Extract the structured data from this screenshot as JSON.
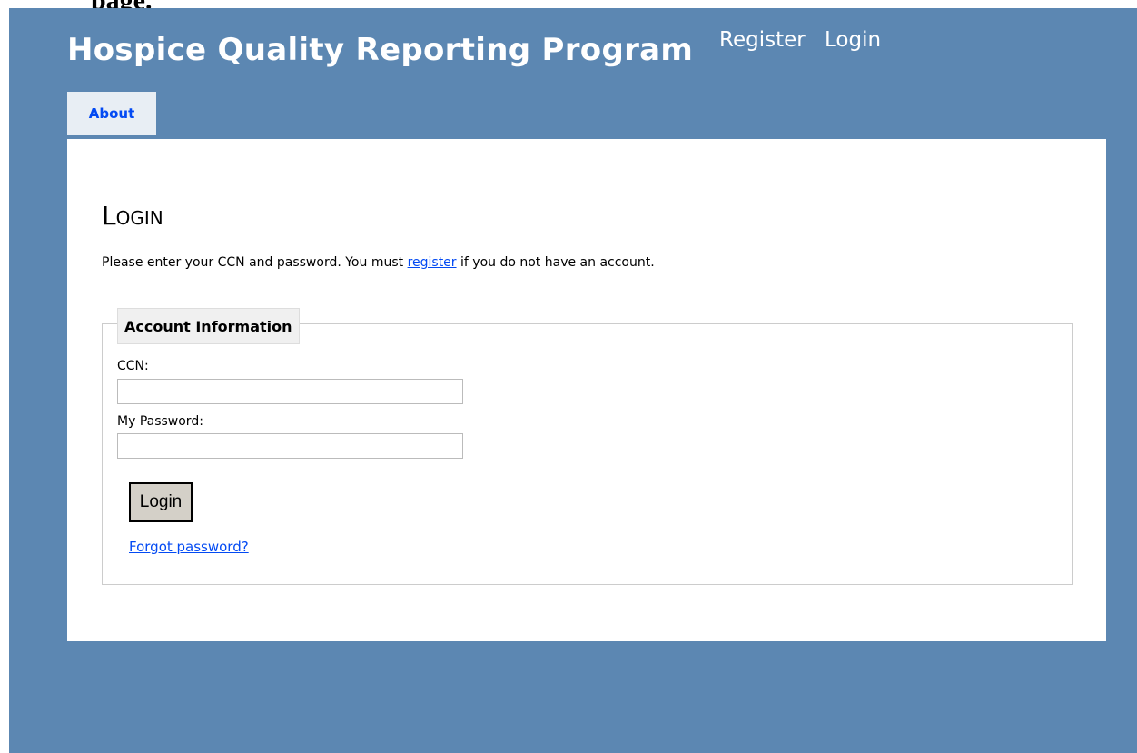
{
  "doc_fragment": "page.",
  "header": {
    "title": "Hospice Quality Reporting Program",
    "links": {
      "register": "Register",
      "login": "Login"
    }
  },
  "nav": {
    "tab_about": "About"
  },
  "main": {
    "heading": "Login",
    "intro": {
      "before": "Please enter your CCN and password. You must ",
      "link": "register",
      "after": " if you do not have an account."
    },
    "fieldset": {
      "legend": "Account Information",
      "ccn_label": "CCN:",
      "ccn_value": "",
      "password_label": "My Password:",
      "password_value": "",
      "login_button": "Login",
      "forgot_link": "Forgot password?"
    }
  },
  "colors": {
    "background": "#5c87b2",
    "link": "#034af3",
    "tab_bg": "#e8eef4"
  }
}
